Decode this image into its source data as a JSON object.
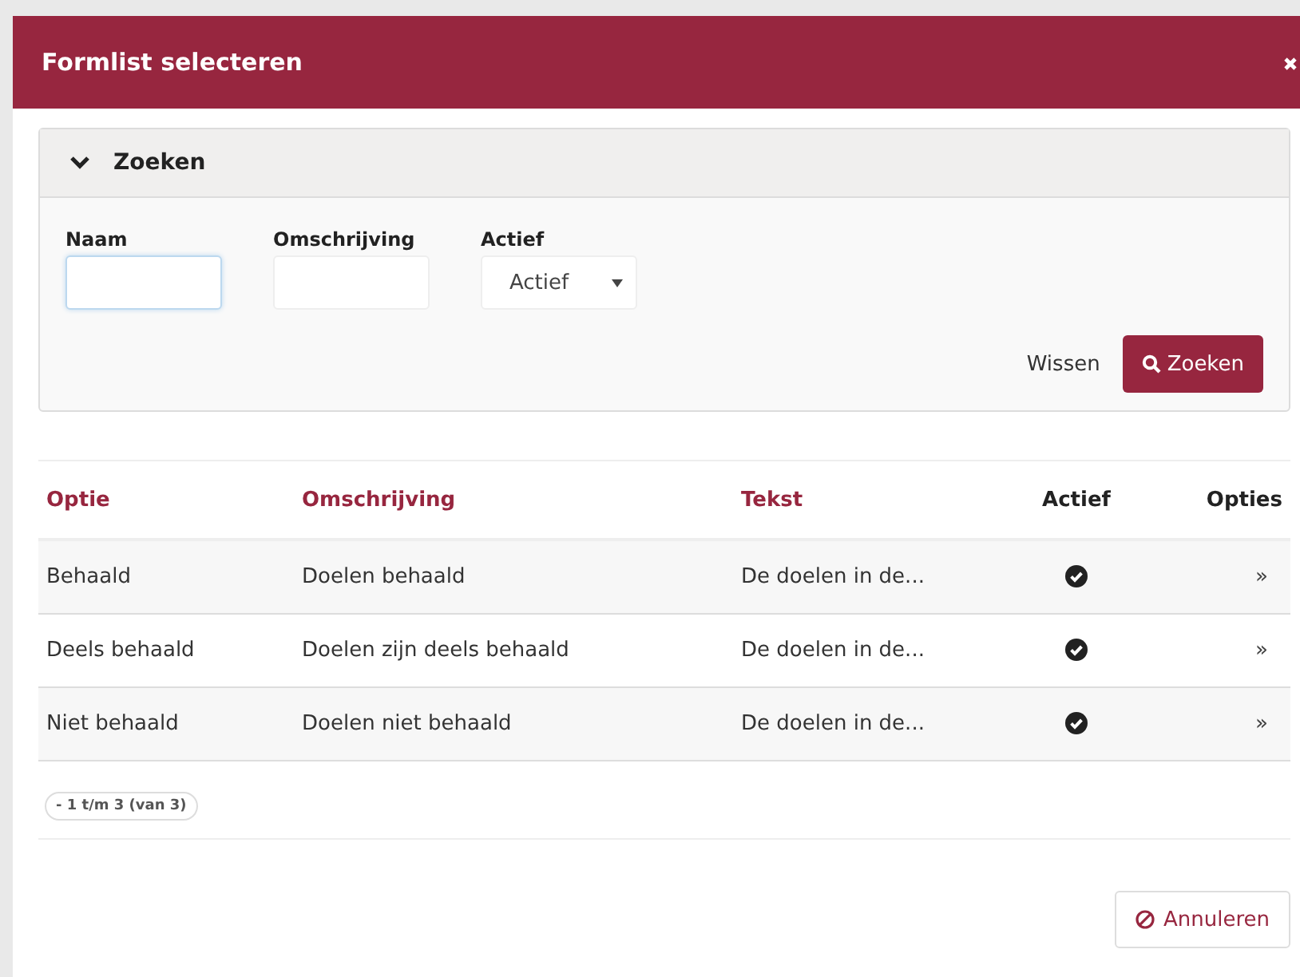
{
  "dialog": {
    "title": "Formlist selecteren"
  },
  "search_panel": {
    "title": "Zoeken",
    "expanded": true,
    "fields": [
      {
        "label": "Naam",
        "kind": "text",
        "focused": true
      },
      {
        "label": "Omschrijving",
        "kind": "text",
        "focused": false
      },
      {
        "label": "Actief",
        "kind": "select",
        "value": "Actief",
        "focused": false
      }
    ],
    "clear_label": "Wissen",
    "search_label": "Zoeken"
  },
  "table": {
    "columns": [
      {
        "label": "Optie",
        "sortable": true
      },
      {
        "label": "Omschrijving",
        "sortable": true
      },
      {
        "label": "Tekst",
        "sortable": true
      },
      {
        "label": "Actief",
        "sortable": false
      },
      {
        "label": "Opties",
        "sortable": false
      }
    ],
    "rows": [
      {
        "optie": "Behaald",
        "omschrijving": "Doelen behaald",
        "tekst": "De doelen in de...",
        "active": true,
        "options": "»"
      },
      {
        "optie": "Deels behaald",
        "omschrijving": "Doelen zijn deels behaald",
        "tekst": "De doelen in de...",
        "active": true,
        "options": "»"
      },
      {
        "optie": "Niet behaald",
        "omschrijving": "Doelen niet behaald",
        "tekst": "De doelen in de...",
        "active": true,
        "options": "»"
      }
    ]
  },
  "pagination": "- 1 t/m 3 (van 3)",
  "cancel_label": "Annuleren"
}
